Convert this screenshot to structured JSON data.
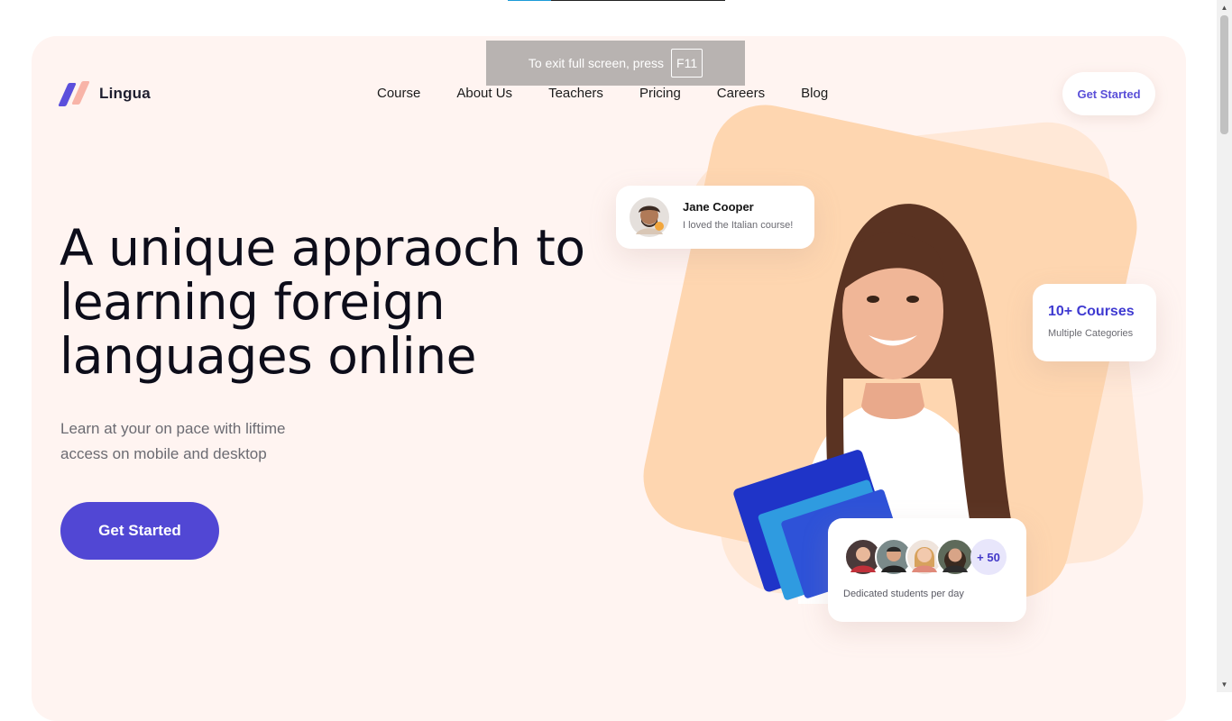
{
  "brand": {
    "name": "Lingua"
  },
  "nav": {
    "items": [
      "Course",
      "About Us",
      "Teachers",
      "Pricing",
      "Careers",
      "Blog"
    ]
  },
  "header": {
    "cta_label": "Get Started"
  },
  "hero": {
    "title": "A unique appraoch to learning foreign languages online",
    "subtitle": "Learn at your on pace with liftime access on mobile and desktop",
    "cta_label": "Get Started"
  },
  "review_card": {
    "name": "Jane Cooper",
    "text": "I loved the Italian course!"
  },
  "courses_card": {
    "title": "10+ Courses",
    "subtitle": "Multiple Categories"
  },
  "students_card": {
    "plus_label": "+ 50",
    "text": "Dedicated students per day"
  },
  "fullscreen_notice": {
    "text": "To exit full screen, press",
    "key": "F11"
  },
  "colors": {
    "accent": "#5147d4",
    "background": "#fff4f1",
    "blob": "#fed6b0"
  }
}
